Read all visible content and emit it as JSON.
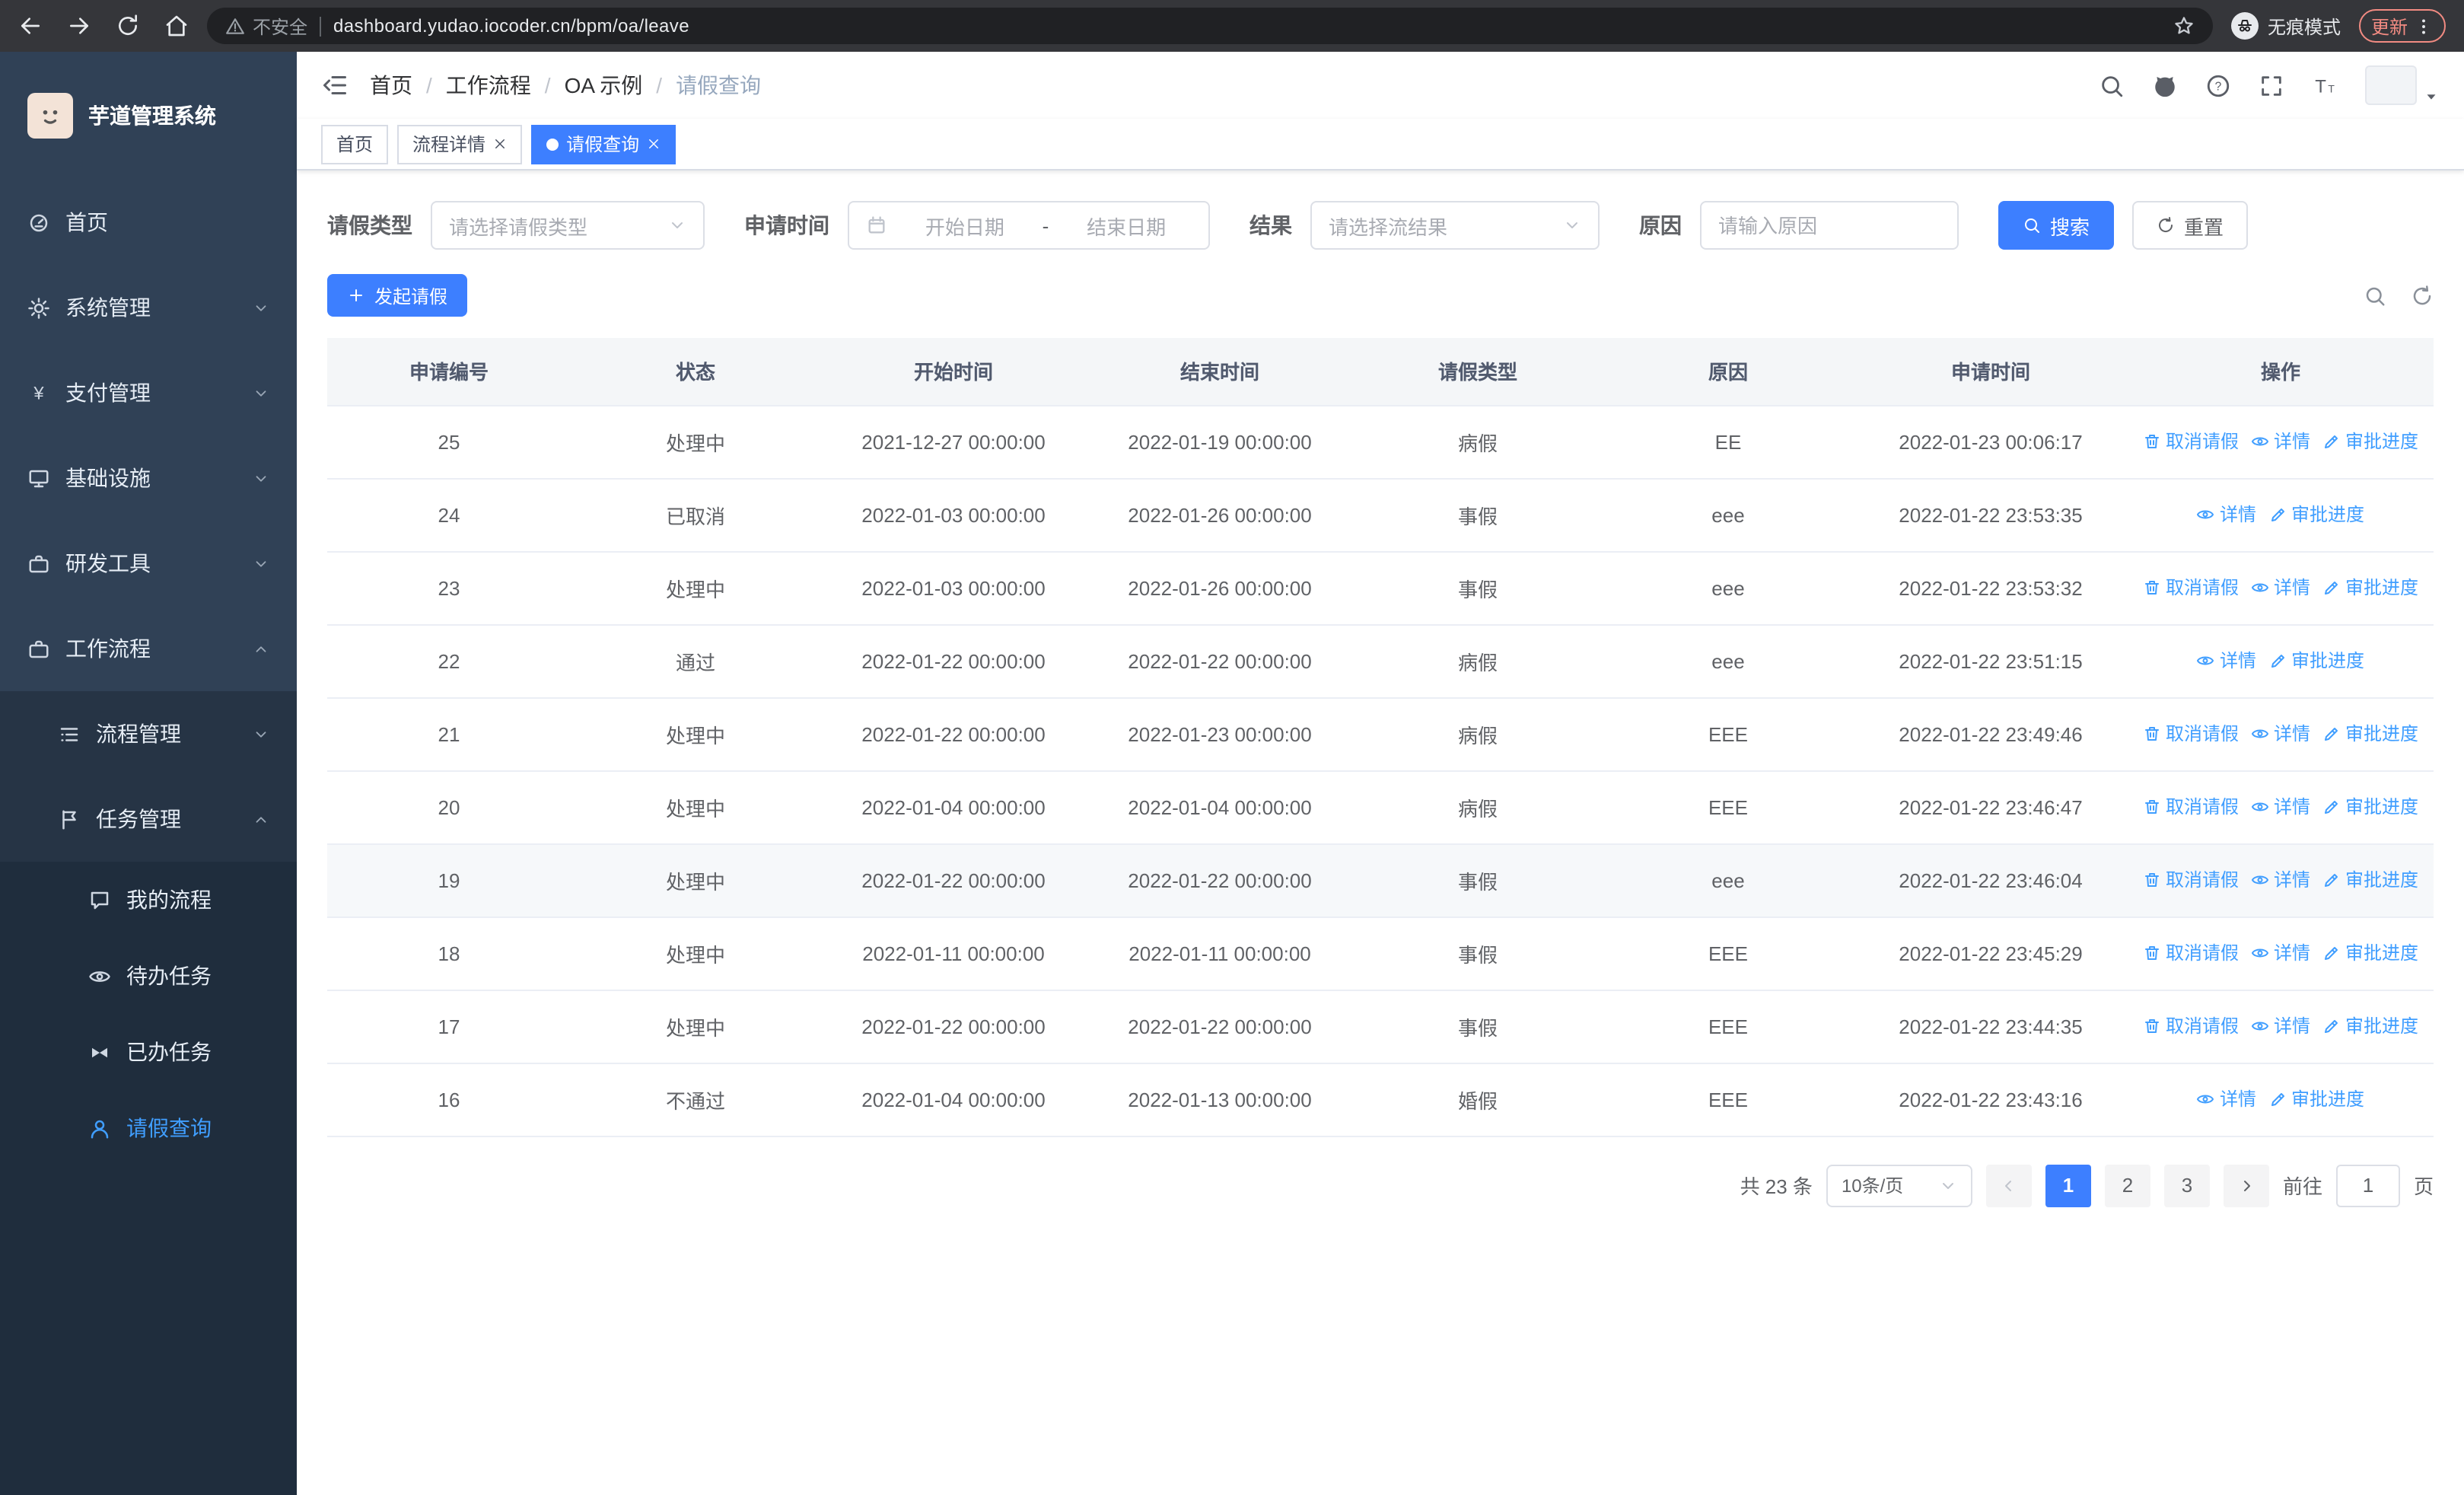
{
  "colors": {
    "accent": "#3d7fff",
    "link": "#409eff",
    "sidebar-bg": "#304156",
    "submenu-bg": "#263445",
    "submenu-deep": "#1f2d3d"
  },
  "browser": {
    "security_warning": "不安全",
    "url": "dashboard.yudao.iocoder.cn/bpm/oa/leave",
    "incognito_label": "无痕模式",
    "update_label": "更新"
  },
  "sidebar": {
    "app_title": "芋道管理系统",
    "menu": [
      {
        "label": "首页",
        "icon": "dashboard",
        "level": 1,
        "chevron": "",
        "active": false
      },
      {
        "label": "系统管理",
        "icon": "gear",
        "level": 1,
        "chevron": "down",
        "active": false
      },
      {
        "label": "支付管理",
        "icon": "yen",
        "level": 1,
        "chevron": "down",
        "active": false
      },
      {
        "label": "基础设施",
        "icon": "monitor",
        "level": 1,
        "chevron": "down",
        "active": false
      },
      {
        "label": "研发工具",
        "icon": "suitcase",
        "level": 1,
        "chevron": "down",
        "active": false
      },
      {
        "label": "工作流程",
        "icon": "suitcase",
        "level": 1,
        "chevron": "up",
        "active": false
      },
      {
        "label": "流程管理",
        "icon": "tree",
        "level": 2,
        "chevron": "down",
        "active": false
      },
      {
        "label": "任务管理",
        "icon": "flag",
        "level": 2,
        "chevron": "up",
        "active": false
      },
      {
        "label": "我的流程",
        "icon": "chat",
        "level": 3,
        "chevron": "",
        "active": false
      },
      {
        "label": "待办任务",
        "icon": "eye",
        "level": 3,
        "chevron": "",
        "active": false
      },
      {
        "label": "已办任务",
        "icon": "bowtie",
        "level": 3,
        "chevron": "",
        "active": false
      },
      {
        "label": "请假查询",
        "icon": "user",
        "level": 3,
        "chevron": "",
        "active": true
      }
    ]
  },
  "header": {
    "breadcrumb": [
      "首页",
      "工作流程",
      "OA 示例",
      "请假查询"
    ]
  },
  "tabs": [
    {
      "label": "首页",
      "active": false,
      "closable": false,
      "dot": false
    },
    {
      "label": "流程详情",
      "active": false,
      "closable": true,
      "dot": false
    },
    {
      "label": "请假查询",
      "active": true,
      "closable": true,
      "dot": true
    }
  ],
  "filters": {
    "leave_type_label": "请假类型",
    "leave_type_placeholder": "请选择请假类型",
    "apply_time_label": "申请时间",
    "start_date_placeholder": "开始日期",
    "date_separator": "-",
    "end_date_placeholder": "结束日期",
    "result_label": "结果",
    "result_placeholder": "请选择流结果",
    "reason_label": "原因",
    "reason_placeholder": "请输入原因",
    "search_label": "搜索",
    "reset_label": "重置"
  },
  "toolbar": {
    "create_label": "发起请假"
  },
  "table": {
    "columns": [
      "申请编号",
      "状态",
      "开始时间",
      "结束时间",
      "请假类型",
      "原因",
      "申请时间",
      "操作"
    ],
    "action_labels": {
      "cancel": "取消请假",
      "detail": "详情",
      "progress": "审批进度"
    },
    "rows": [
      {
        "id": "25",
        "status": "处理中",
        "start": "2021-12-27 00:00:00",
        "end": "2022-01-19 00:00:00",
        "type": "病假",
        "reason": "EE",
        "apply_time": "2022-01-23 00:06:17",
        "actions": [
          "cancel",
          "detail",
          "progress"
        ],
        "highlight": false
      },
      {
        "id": "24",
        "status": "已取消",
        "start": "2022-01-03 00:00:00",
        "end": "2022-01-26 00:00:00",
        "type": "事假",
        "reason": "eee",
        "apply_time": "2022-01-22 23:53:35",
        "actions": [
          "detail",
          "progress"
        ],
        "highlight": false
      },
      {
        "id": "23",
        "status": "处理中",
        "start": "2022-01-03 00:00:00",
        "end": "2022-01-26 00:00:00",
        "type": "事假",
        "reason": "eee",
        "apply_time": "2022-01-22 23:53:32",
        "actions": [
          "cancel",
          "detail",
          "progress"
        ],
        "highlight": false
      },
      {
        "id": "22",
        "status": "通过",
        "start": "2022-01-22 00:00:00",
        "end": "2022-01-22 00:00:00",
        "type": "病假",
        "reason": "eee",
        "apply_time": "2022-01-22 23:51:15",
        "actions": [
          "detail",
          "progress"
        ],
        "highlight": false
      },
      {
        "id": "21",
        "status": "处理中",
        "start": "2022-01-22 00:00:00",
        "end": "2022-01-23 00:00:00",
        "type": "病假",
        "reason": "EEE",
        "apply_time": "2022-01-22 23:49:46",
        "actions": [
          "cancel",
          "detail",
          "progress"
        ],
        "highlight": false
      },
      {
        "id": "20",
        "status": "处理中",
        "start": "2022-01-04 00:00:00",
        "end": "2022-01-04 00:00:00",
        "type": "病假",
        "reason": "EEE",
        "apply_time": "2022-01-22 23:46:47",
        "actions": [
          "cancel",
          "detail",
          "progress"
        ],
        "highlight": false
      },
      {
        "id": "19",
        "status": "处理中",
        "start": "2022-01-22 00:00:00",
        "end": "2022-01-22 00:00:00",
        "type": "事假",
        "reason": "eee",
        "apply_time": "2022-01-22 23:46:04",
        "actions": [
          "cancel",
          "detail",
          "progress"
        ],
        "highlight": true
      },
      {
        "id": "18",
        "status": "处理中",
        "start": "2022-01-11 00:00:00",
        "end": "2022-01-11 00:00:00",
        "type": "事假",
        "reason": "EEE",
        "apply_time": "2022-01-22 23:45:29",
        "actions": [
          "cancel",
          "detail",
          "progress"
        ],
        "highlight": false
      },
      {
        "id": "17",
        "status": "处理中",
        "start": "2022-01-22 00:00:00",
        "end": "2022-01-22 00:00:00",
        "type": "事假",
        "reason": "EEE",
        "apply_time": "2022-01-22 23:44:35",
        "actions": [
          "cancel",
          "detail",
          "progress"
        ],
        "highlight": false
      },
      {
        "id": "16",
        "status": "不通过",
        "start": "2022-01-04 00:00:00",
        "end": "2022-01-13 00:00:00",
        "type": "婚假",
        "reason": "EEE",
        "apply_time": "2022-01-22 23:43:16",
        "actions": [
          "detail",
          "progress"
        ],
        "highlight": false
      }
    ]
  },
  "pagination": {
    "total": "共 23 条",
    "page_size": "10条/页",
    "pages": [
      "1",
      "2",
      "3"
    ],
    "active_page": "1",
    "goto_label": "前往",
    "goto_value": "1",
    "unit_label": "页"
  }
}
